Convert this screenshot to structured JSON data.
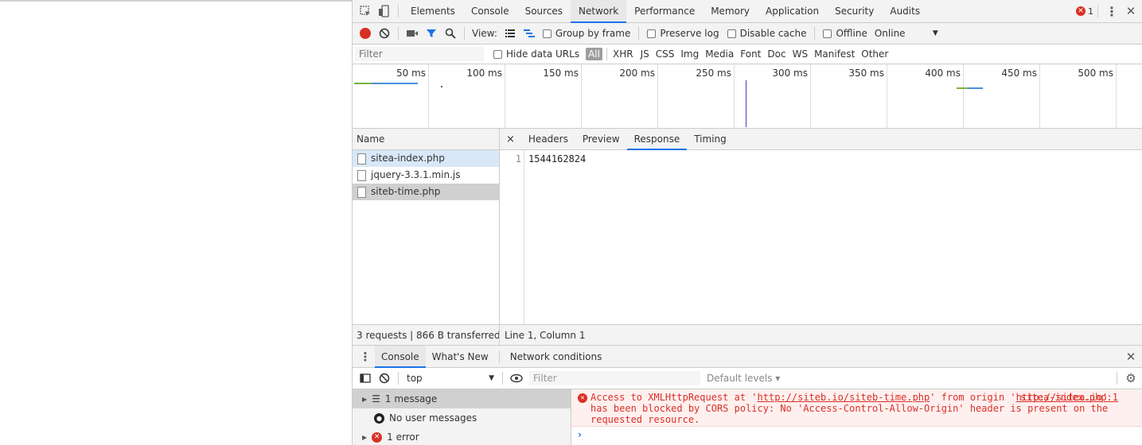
{
  "tabs": [
    "Elements",
    "Console",
    "Sources",
    "Network",
    "Performance",
    "Memory",
    "Application",
    "Security",
    "Audits"
  ],
  "active_tab": "Network",
  "error_count": "1",
  "toolbar": {
    "view_label": "View:",
    "group_by_frame": "Group by frame",
    "preserve_log": "Preserve log",
    "disable_cache": "Disable cache",
    "offline": "Offline",
    "throttle": "Online"
  },
  "filter": {
    "placeholder": "Filter",
    "hide_data_urls": "Hide data URLs",
    "types": [
      "All",
      "XHR",
      "JS",
      "CSS",
      "Img",
      "Media",
      "Font",
      "Doc",
      "WS",
      "Manifest",
      "Other"
    ]
  },
  "timeline": {
    "ticks": [
      "50 ms",
      "100 ms",
      "150 ms",
      "200 ms",
      "250 ms",
      "300 ms",
      "350 ms",
      "400 ms",
      "450 ms",
      "500 ms"
    ]
  },
  "requests": {
    "header": "Name",
    "items": [
      "sitea-index.php",
      "jquery-3.3.1.min.js",
      "siteb-time.php"
    ]
  },
  "detail": {
    "close": "×",
    "tabs": [
      "Headers",
      "Preview",
      "Response",
      "Timing"
    ],
    "active_tab": "Response",
    "line_number": "1",
    "response": "1544162824"
  },
  "status": {
    "summary": "3 requests | 866 B transferred …",
    "position": "Line 1, Column 1"
  },
  "drawer": {
    "tabs": [
      "Console",
      "What's New",
      "Network conditions"
    ],
    "active_tab": "Console"
  },
  "console": {
    "context": "top",
    "filter_placeholder": "Filter",
    "levels": "Default levels ▾",
    "sidebar": [
      "1 message",
      "No user messages",
      "1 error"
    ],
    "error": {
      "p1": "Access to XMLHttpRequest at '",
      "url1": "http://siteb.io/siteb-time.php",
      "p2": "' from origin '",
      "url2": "http://sitea.io",
      "p3": "' has been blocked by CORS policy: No 'Access-Control-Allow-Origin' header is present on the requested resource.",
      "source": "sitea-index.php:1"
    }
  }
}
